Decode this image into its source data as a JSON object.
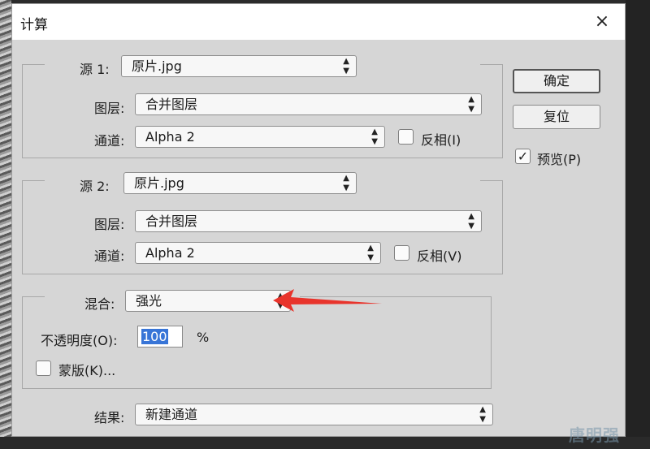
{
  "window": {
    "title": "计算",
    "close_icon": "×"
  },
  "source1": {
    "label": "源 1:",
    "file": "原片.jpg",
    "layer_label": "图层:",
    "layer_value": "合并图层",
    "channel_label": "通道:",
    "channel_value": "Alpha 2",
    "invert_label": "反相(I)",
    "invert_checked": false
  },
  "source2": {
    "label": "源 2:",
    "file": "原片.jpg",
    "layer_label": "图层:",
    "layer_value": "合并图层",
    "channel_label": "通道:",
    "channel_value": "Alpha 2",
    "invert_label": "反相(V)",
    "invert_checked": false
  },
  "blend": {
    "label": "混合:",
    "value": "强光",
    "opacity_label": "不透明度(O):",
    "opacity_value": "100",
    "opacity_unit": "%",
    "mask_label": "蒙版(K)...",
    "mask_checked": false
  },
  "result": {
    "label": "结果:",
    "value": "新建通道"
  },
  "buttons": {
    "ok": "确定",
    "reset": "复位"
  },
  "preview": {
    "label": "预览(P)",
    "checked": true,
    "check_mark": "✓"
  },
  "select_arrows": {
    "up": "▲",
    "down": "▼"
  },
  "watermark": "唐明强",
  "colors": {
    "annotation_arrow": "#e8342c",
    "selection": "#3875d7"
  }
}
